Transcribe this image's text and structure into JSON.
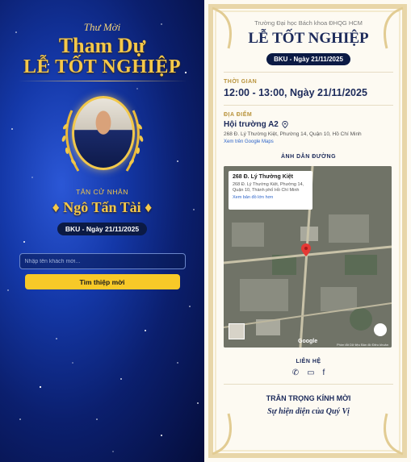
{
  "left": {
    "greeting": "Thư Mời",
    "title_line1": "Tham Dự",
    "title_line2": "LỄ TỐT NGHIỆP",
    "degree_label": "TÂN CỬ NHÂN",
    "graduate_name": "♦ Ngô Tấn Tài ♦",
    "date_badge": "BKU - Ngày 21/11/2025",
    "guest_placeholder": "Nhập tên khách mời...",
    "search_button": "Tìm thiệp mời"
  },
  "right": {
    "university": "Trường Đại học Bách khoa ĐHQG HCM",
    "title": "LỄ TỐT NGHIỆP",
    "date_badge": "BKU - Ngày 21/11/2025",
    "time_label": "THỜI GIAN",
    "time_value": "12:00 - 13:00, Ngày 21/11/2025",
    "location_label": "ĐỊA ĐIỂM",
    "location_name": "Hội trường A2",
    "location_address": "268 Đ. Lý Thường Kiệt, Phường 14, Quận 10, Hồ Chí Minh",
    "map_link": "Xem trên Google Maps",
    "directions_label": "ẢNH DẪN ĐƯỜNG",
    "map": {
      "card_title": "268 Đ. Lý Thường Kiệt",
      "card_address": "268 Đ. Lý Thường Kiệt, Phường 14, Quận 10, Thành phố Hồ Chí Minh",
      "card_link": "Xem bản đồ lớn hơn",
      "google_logo": "Google",
      "footer": "Phím tắt   Dữ liệu Bản đồ   Điều khoản"
    },
    "contact_label": "LIÊN HỆ",
    "closing_line1": "TRÂN TRỌNG KÍNH MỜI",
    "closing_line2": "Sự hiện diện của Quý Vị"
  },
  "colors": {
    "gold": "#f5c84a",
    "navy": "#1c2a5a",
    "accent_button": "#f7c928"
  }
}
